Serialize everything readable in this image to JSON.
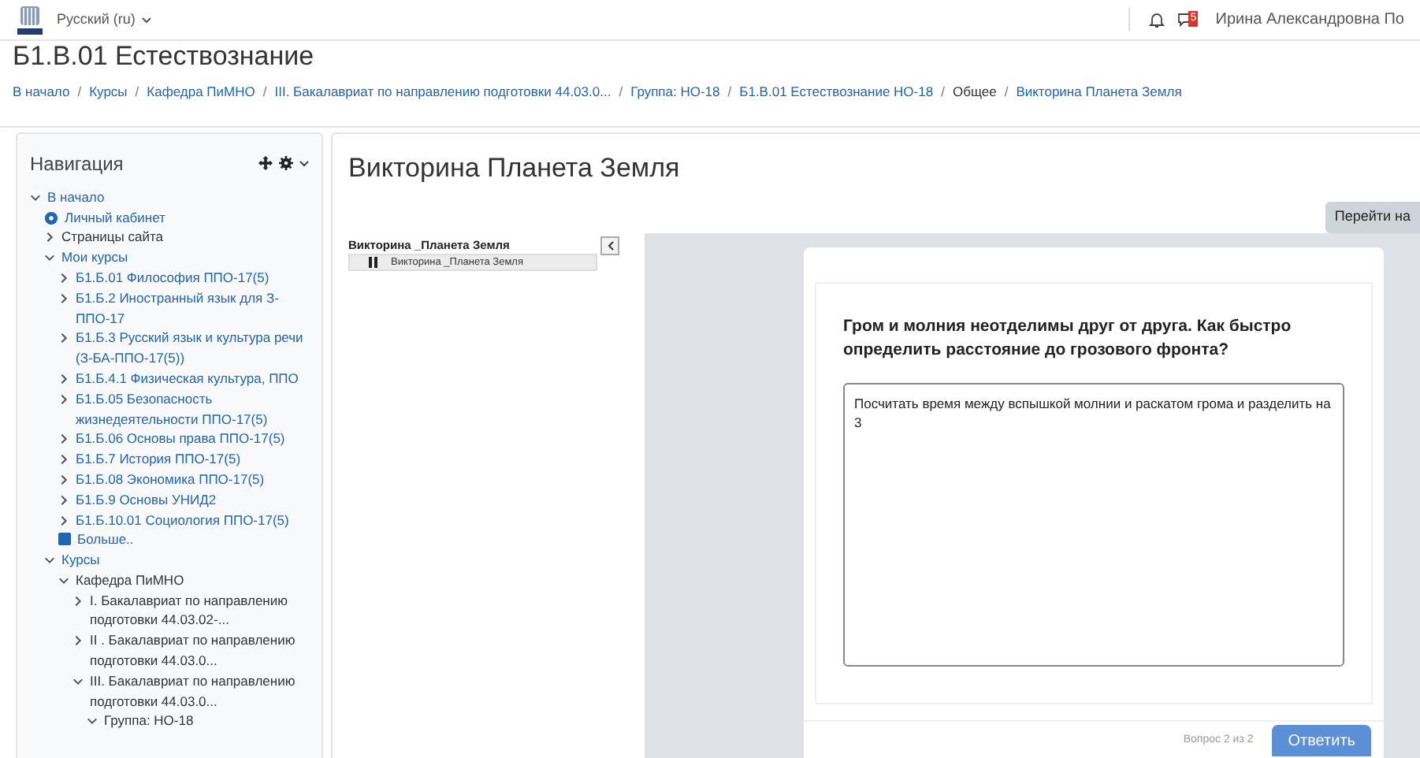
{
  "header": {
    "language": "Русский (ru)",
    "notifications_badge": "5",
    "user": "Ирина Александровна По"
  },
  "course_title": "Б1.В.01 Естествознание",
  "breadcrumb_separator": "/",
  "breadcrumb": [
    {
      "label": "В начало",
      "link": true
    },
    {
      "label": "Курсы",
      "link": true
    },
    {
      "label": "Кафедра ПиМНО",
      "link": true
    },
    {
      "label": "III. Бакалавриат по направлению подготовки 44.03.0...",
      "link": true
    },
    {
      "label": "Группа: НО-18",
      "link": true
    },
    {
      "label": "Б1.В.01 Естествознание НО-18",
      "link": true
    },
    {
      "label": "Общее",
      "link": false
    },
    {
      "label": "Викторина Планета Земля",
      "link": true
    }
  ],
  "navigation": {
    "title": "Навигация",
    "items": [
      {
        "kind": "node",
        "label": "В начало",
        "link": true,
        "expanded": true,
        "children": [
          {
            "kind": "icon",
            "label": "Личный кабинет",
            "link": true
          },
          {
            "kind": "node",
            "label": "Страницы сайта",
            "link": false,
            "expanded": false
          },
          {
            "kind": "node",
            "label": "Мои курсы",
            "link": true,
            "expanded": true,
            "children": [
              {
                "kind": "node",
                "label": "Б1.Б.01 Философия ППО-17(5)",
                "link": true,
                "expanded": false
              },
              {
                "kind": "node",
                "label": "Б1.Б.2 Иностранный язык для З-ППО-17",
                "link": true,
                "expanded": false
              },
              {
                "kind": "node",
                "label": "Б1.Б.3 Русский язык и культура речи (З-БА-ППО-17(5))",
                "link": true,
                "expanded": false
              },
              {
                "kind": "node",
                "label": "Б1.Б.4.1 Физическая культура, ППО",
                "link": true,
                "expanded": false
              },
              {
                "kind": "node",
                "label": "Б1.Б.05 Безопасность жизнедеятельности ППО-17(5)",
                "link": true,
                "expanded": false
              },
              {
                "kind": "node",
                "label": "Б1.Б.06 Основы права ППО-17(5)",
                "link": true,
                "expanded": false
              },
              {
                "kind": "node",
                "label": "Б1.Б.7 История ППО-17(5)",
                "link": true,
                "expanded": false
              },
              {
                "kind": "node",
                "label": "Б1.Б.08 Экономика ППО-17(5)",
                "link": true,
                "expanded": false
              },
              {
                "kind": "node",
                "label": "Б1.Б.9 Основы УНИД2",
                "link": true,
                "expanded": false
              },
              {
                "kind": "node",
                "label": "Б1.Б.10.01 Социология ППО-17(5)",
                "link": true,
                "expanded": false
              },
              {
                "kind": "icon",
                "label": "Больше..",
                "link": true
              }
            ]
          },
          {
            "kind": "node",
            "label": "Курсы",
            "link": true,
            "expanded": true,
            "children": [
              {
                "kind": "node",
                "label": "Кафедра ПиМНО",
                "link": false,
                "expanded": true,
                "children": [
                  {
                    "kind": "node",
                    "label": "I. Бакалавриат по направлению подготовки 44.03.02-...",
                    "link": false,
                    "expanded": false
                  },
                  {
                    "kind": "node",
                    "label": "II . Бакалавриат по направлению подготовки 44.03.0...",
                    "link": false,
                    "expanded": false
                  },
                  {
                    "kind": "node",
                    "label": "III. Бакалавриат по направлению подготовки 44.03.0...",
                    "link": false,
                    "expanded": true,
                    "children": [
                      {
                        "kind": "node",
                        "label": "Группа: НО-18",
                        "link": false,
                        "expanded": true
                      }
                    ]
                  }
                ]
              }
            ]
          }
        ]
      }
    ]
  },
  "activity": {
    "title": "Викторина Планета Земля",
    "jump_button": "Перейти на",
    "toc": {
      "title": "Викторина _Планета Земля",
      "items": [
        {
          "label": "Викторина _Планета Земля",
          "selected": true
        }
      ]
    },
    "question": {
      "text": "Гром и молния неотделимы друг от друга. Как быстро определить расстояние до грозового фронта?",
      "answer": "Посчитать время между вспышкой молнии и раскатом грома и разделить на 3",
      "counter": "Вопрос 2 из 2",
      "submit": "Ответить"
    }
  }
}
